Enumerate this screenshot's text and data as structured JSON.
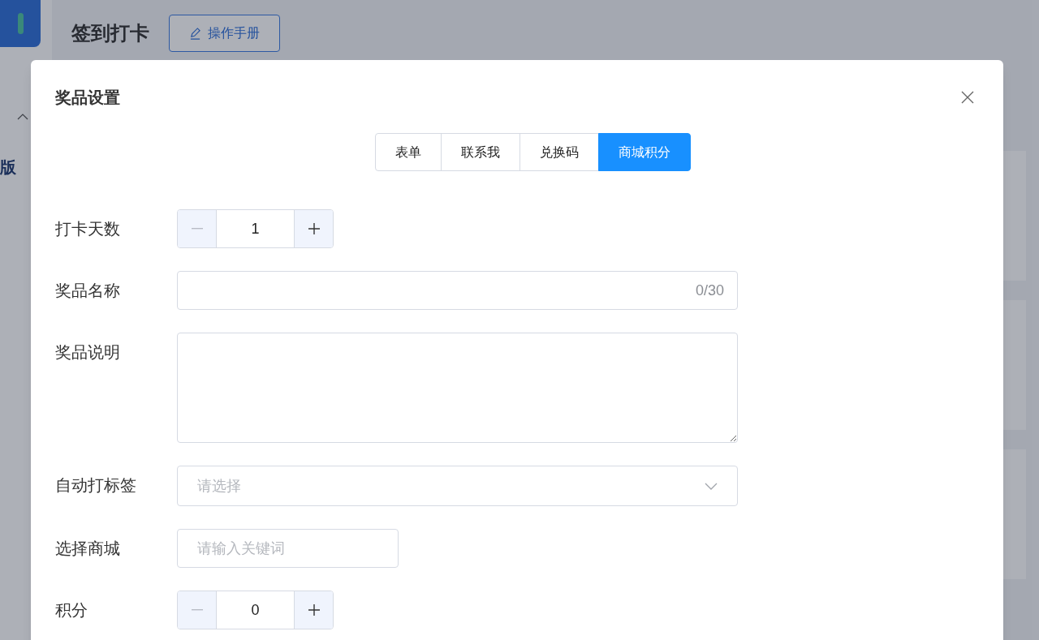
{
  "page": {
    "sidebar": {
      "section_label": "版"
    },
    "title": "签到打卡",
    "manual_button": "操作手册"
  },
  "dialog": {
    "title": "奖品设置",
    "tabs": [
      {
        "label": "表单",
        "selected": false
      },
      {
        "label": "联系我",
        "selected": false
      },
      {
        "label": "兑换码",
        "selected": false
      },
      {
        "label": "商城积分",
        "selected": true
      }
    ],
    "fields": [
      {
        "kind": "stepper",
        "label": "打卡天数",
        "value": "1",
        "decrement_disabled": true
      },
      {
        "kind": "text",
        "label": "奖品名称",
        "counter": "0/30"
      },
      {
        "kind": "textarea",
        "label": "奖品说明"
      },
      {
        "kind": "select",
        "label": "自动打标签",
        "placeholder": "请选择"
      },
      {
        "kind": "search",
        "label": "选择商城",
        "placeholder": "请输入关键词"
      },
      {
        "kind": "stepper",
        "label": "积分",
        "value": "0",
        "decrement_disabled": true
      }
    ]
  }
}
